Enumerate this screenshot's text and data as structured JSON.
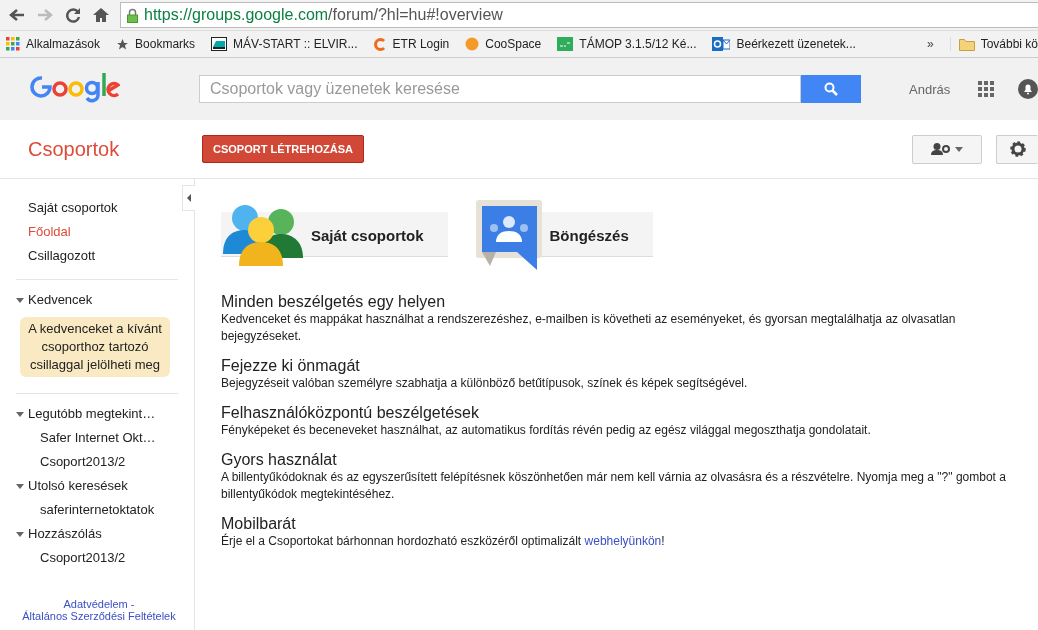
{
  "browser": {
    "url_host": "https://groups.google.com",
    "url_path": "/forum/?hl=hu#!overview",
    "bookmarks": [
      {
        "label": "Alkalmazások",
        "kind": "apps"
      },
      {
        "label": "Bookmarks",
        "kind": "star"
      },
      {
        "label": "MÁV-START :: ELVIR...",
        "kind": "train"
      },
      {
        "label": "ETR Login",
        "kind": "e"
      },
      {
        "label": "CooSpace",
        "kind": "orb"
      },
      {
        "label": "TÁMOP 3.1.5/12 Ké...",
        "kind": "green"
      },
      {
        "label": "Beérkezett üzenetek...",
        "kind": "outlook"
      }
    ],
    "overflow": "»",
    "other_bookmarks": "További kö"
  },
  "header": {
    "search": {
      "placeholder": "Csoportok vagy üzenetek keresése"
    },
    "user": "András"
  },
  "subheader": {
    "title": "Csoportok",
    "create_button": "CSOPORT LÉTREHOZÁSA"
  },
  "sidebar": {
    "nav": [
      {
        "label": "Saját csoportok",
        "selected": false
      },
      {
        "label": "Főoldal",
        "selected": true
      },
      {
        "label": "Csillagozott",
        "selected": false
      }
    ],
    "favorites": {
      "label": "Kedvencek",
      "expanded": true,
      "hint": "A kedvenceket a kívánt csoporthoz tartozó csillaggal jelölheti meg"
    },
    "sections": [
      {
        "label": "Legutóbb megtekint…",
        "expanded": true,
        "children": [
          {
            "label": "Safer Internet Okt…"
          },
          {
            "label": "Csoport2013/2"
          }
        ]
      },
      {
        "label": "Utolsó keresések",
        "expanded": true,
        "children": [
          {
            "label": "saferinternetoktatok"
          }
        ]
      },
      {
        "label": "Hozzászólás",
        "expanded": true,
        "children": [
          {
            "label": "Csoport2013/2"
          }
        ]
      }
    ],
    "footer_links": [
      "Adatvédelem -",
      "Általános Szerződési Feltételek"
    ]
  },
  "tiles": [
    {
      "label": "Saját csoportok",
      "kind": "people"
    },
    {
      "label": "Böngészés",
      "kind": "browse"
    }
  ],
  "features": [
    {
      "title": "Minden beszélgetés egy helyen",
      "parts": [
        {
          "kind": "text",
          "text": "Kedvenceket és mappákat használhat a rendszerezéshez, e-mailben is követheti az eseményeket, és gyorsan megtalálhatja az olvasatlan bejegyzéseket."
        }
      ]
    },
    {
      "title": "Fejezze ki önmagát",
      "parts": [
        {
          "kind": "text",
          "text": "Bejegyzéseit valóban személyre szabhatja a különböző betűtípusok, színek és képek segítségével."
        }
      ]
    },
    {
      "title": "Felhasználóközpontú beszélgetések",
      "parts": [
        {
          "kind": "text",
          "text": "Fényképeket és beceneveket használhat, az automatikus fordítás révén pedig az egész világgal megoszthatja gondolatait."
        }
      ]
    },
    {
      "title": "Gyors használat",
      "parts": [
        {
          "kind": "text",
          "text": "A billentyűkódoknak és az egyszerűsített felépítésnek köszönhetően már nem kell várnia az olvasásra és a részvételre. Nyomja meg a \"?\" gombot a billentyűkódok megtekintéséhez."
        }
      ]
    },
    {
      "title": "Mobilbarát",
      "parts": [
        {
          "kind": "text",
          "text": "Érje el a Csoportokat bárhonnan hordozható eszközéről optimalizált "
        },
        {
          "kind": "link",
          "text": "webhelyünkön"
        },
        {
          "kind": "text",
          "text": "!"
        }
      ]
    }
  ]
}
